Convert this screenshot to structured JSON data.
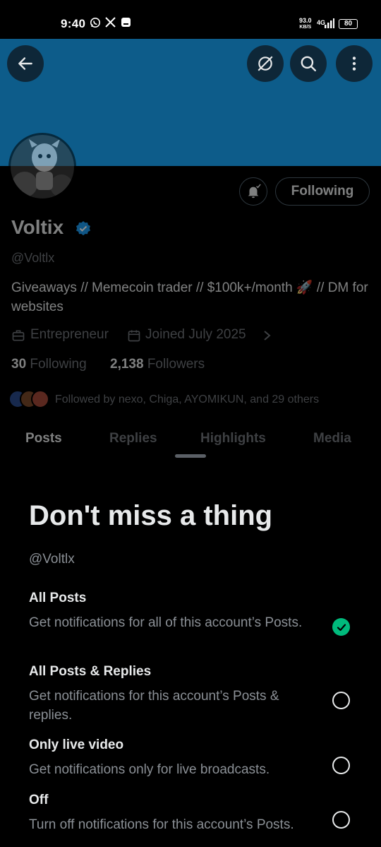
{
  "status_bar": {
    "time": "9:40",
    "net_speed": "93.0",
    "net_unit": "KB/S",
    "network": "4G",
    "battery": "80"
  },
  "profile": {
    "name": "Voltix",
    "handle": "@Voltlx",
    "bio": "Giveaways // Memecoin trader // $100k+/month 🚀 // DM for websites",
    "category": "Entrepreneur",
    "joined": "Joined July 2025",
    "following_count": "30",
    "following_label": "Following",
    "followers_count": "2,138",
    "followers_label": "Followers",
    "followed_by": "Followed by nexo, Chiga, AYOMIKUN, and 29 others",
    "follow_button": "Following"
  },
  "tabs": [
    "Posts",
    "Replies",
    "Highlights",
    "Media"
  ],
  "sheet": {
    "title": "Don't miss a thing",
    "handle": "@Voltlx",
    "options": [
      {
        "title": "All Posts",
        "desc": "Get notifications for all of this account’s Posts.",
        "selected": true
      },
      {
        "title": "All Posts & Replies",
        "desc": "Get notifications for this account’s Posts & replies.",
        "selected": false
      },
      {
        "title": "Only live video",
        "desc": "Get notifications only for live broadcasts.",
        "selected": false
      },
      {
        "title": "Off",
        "desc": "Turn off notifications for this account’s Posts.",
        "selected": false
      }
    ]
  },
  "colors": {
    "banner": "#0d5c8a",
    "accent": "#1d9bf0",
    "check": "#00ba7c"
  },
  "icons": [
    "back-arrow-icon",
    "grok-icon",
    "search-icon",
    "more-vertical-icon",
    "bell-icon",
    "verified-badge-icon",
    "briefcase-icon",
    "calendar-icon",
    "chevron-right-icon",
    "checkmark-icon"
  ]
}
